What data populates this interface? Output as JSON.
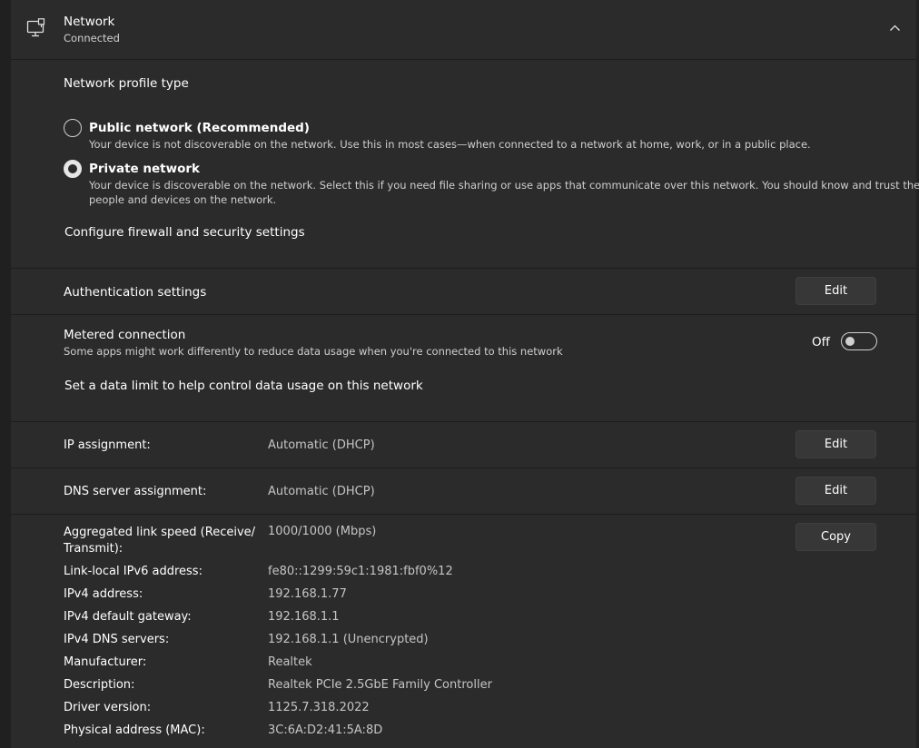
{
  "header": {
    "title": "Network",
    "status": "Connected",
    "icon": "ethernet-monitor-icon",
    "collapse_icon": "chevron-up-icon"
  },
  "profile": {
    "heading": "Network profile type",
    "options": [
      {
        "label": "Public network (Recommended)",
        "description": "Your device is not discoverable on the network. Use this in most cases—when connected to a network at home, work, or in a public place.",
        "selected": false
      },
      {
        "label": "Private network",
        "description_line1": "Your device is discoverable on the network. Select this if you need file sharing or use apps that communicate over this network. You should know and trust the",
        "description_line2": "people and devices on the network.",
        "selected": true
      }
    ],
    "firewall_link": "Configure firewall and security settings"
  },
  "authentication": {
    "label": "Authentication settings",
    "button": "Edit"
  },
  "metered": {
    "title": "Metered connection",
    "description": "Some apps might work differently to reduce data usage when you're connected to this network",
    "toggle_state": "Off",
    "data_limit_link": "Set a data limit to help control data usage on this network"
  },
  "ip_assignment": {
    "label": "IP assignment:",
    "value": "Automatic (DHCP)",
    "button": "Edit"
  },
  "dns_assignment": {
    "label": "DNS server assignment:",
    "value": "Automatic (DHCP)",
    "button": "Edit"
  },
  "properties": {
    "copy_button": "Copy",
    "link_speed_label_line1": "Aggregated link speed (Receive/",
    "link_speed_label_line2": "Transmit):",
    "link_speed_value": "1000/1000 (Mbps)",
    "rows": [
      {
        "label": "Link-local IPv6 address:",
        "value": "fe80::1299:59c1:1981:fbf0%12"
      },
      {
        "label": "IPv4 address:",
        "value": "192.168.1.77"
      },
      {
        "label": "IPv4 default gateway:",
        "value": "192.168.1.1"
      },
      {
        "label": "IPv4 DNS servers:",
        "value": "192.168.1.1 (Unencrypted)"
      },
      {
        "label": "Manufacturer:",
        "value": "Realtek"
      },
      {
        "label": "Description:",
        "value": "Realtek PCIe 2.5GbE Family Controller"
      },
      {
        "label": "Driver version:",
        "value": "1125.7.318.2022"
      },
      {
        "label": "Physical address (MAC):",
        "value": "3C:6A:D2:41:5A:8D"
      }
    ]
  }
}
